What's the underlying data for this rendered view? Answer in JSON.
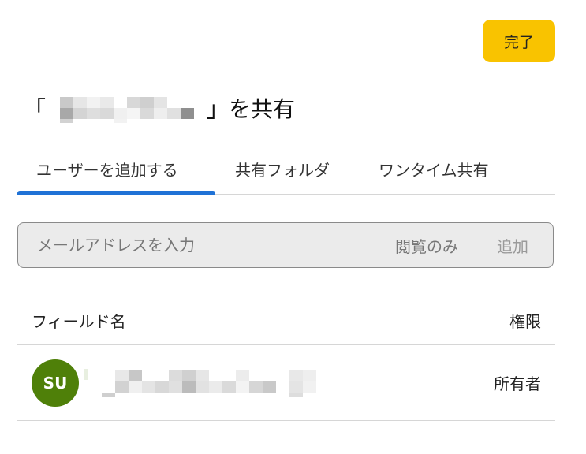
{
  "header": {
    "done_label": "完了"
  },
  "title": {
    "open_bracket": "「",
    "close_bracket": "」を共有"
  },
  "tabs": [
    {
      "label": "ユーザーを追加する",
      "active": true
    },
    {
      "label": "共有フォルダ",
      "active": false
    },
    {
      "label": "ワンタイム共有",
      "active": false
    }
  ],
  "add_user": {
    "email_placeholder": "メールアドレスを入力",
    "permission_value": "閲覧のみ",
    "add_label": "追加"
  },
  "list": {
    "name_header": "フィールド名",
    "permission_header": "権限",
    "users": [
      {
        "initials": "SU",
        "permission": "所有者"
      }
    ]
  },
  "colors": {
    "accent": "#f9c300",
    "tab_active": "#1f72d6",
    "avatar": "#4f8009"
  }
}
